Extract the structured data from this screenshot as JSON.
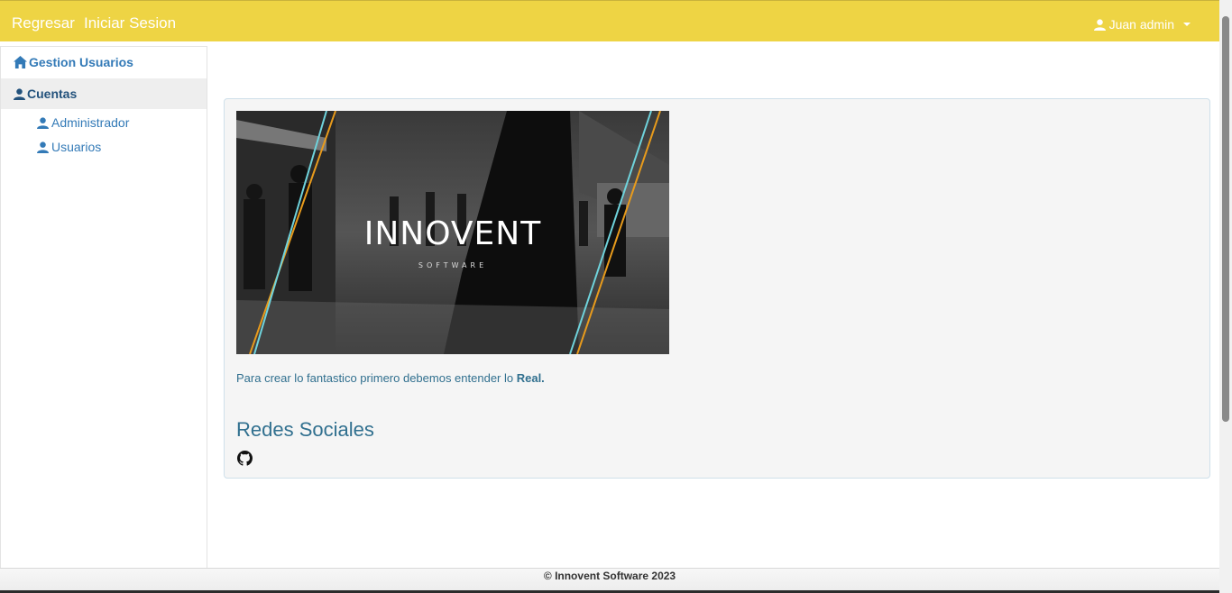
{
  "topbar": {
    "back_label": "Regresar",
    "login_label": "Iniciar Sesion",
    "user_label": "Juan admin",
    "color": "#eed444"
  },
  "sidebar": {
    "items": [
      {
        "label": "Gestion Usuarios",
        "icon": "home-icon"
      },
      {
        "label": "Cuentas",
        "icon": "user-icon"
      }
    ],
    "subitems": [
      {
        "label": "Administrador",
        "icon": "user-icon"
      },
      {
        "label": "Usuarios",
        "icon": "user-icon"
      }
    ]
  },
  "main": {
    "banner": {
      "title": "INNOVENT",
      "subtitle": "SOFTWARE"
    },
    "tagline_text": "Para crear lo fantastico primero debemos entender lo ",
    "tagline_bold": "Real.",
    "social_heading": "Redes Sociales",
    "social_icon": "github-icon"
  },
  "footer": {
    "text": "© Innovent Software 2023"
  }
}
